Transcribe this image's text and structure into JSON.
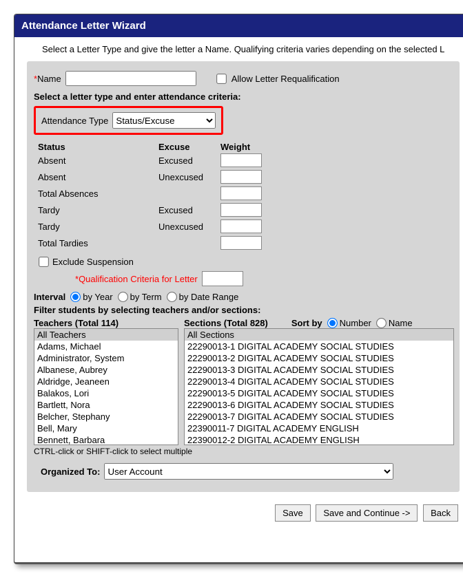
{
  "title": "Attendance Letter Wizard",
  "intro": "Select a Letter Type and give the letter a Name. Qualifying criteria varies depending on the selected L",
  "name": {
    "label": "Name",
    "value": ""
  },
  "allow_requal": {
    "label": "Allow Letter Requalification",
    "checked": false
  },
  "criteria_prompt": "Select a letter type and enter attendance criteria:",
  "attendance_type": {
    "label": "Attendance Type",
    "value": "Status/Excuse"
  },
  "columns": {
    "status": "Status",
    "excuse": "Excuse",
    "weight": "Weight"
  },
  "rows": [
    {
      "status": "Absent",
      "excuse": "Excused",
      "weight": ""
    },
    {
      "status": "Absent",
      "excuse": "Unexcused",
      "weight": ""
    },
    {
      "status": "Total Absences",
      "excuse": "",
      "weight": ""
    },
    {
      "status": "Tardy",
      "excuse": "Excused",
      "weight": ""
    },
    {
      "status": "Tardy",
      "excuse": "Unexcused",
      "weight": ""
    },
    {
      "status": "Total Tardies",
      "excuse": "",
      "weight": ""
    }
  ],
  "exclude_suspension": {
    "label": "Exclude Suspension",
    "checked": false
  },
  "qualification": {
    "label": "Qualification Criteria for Letter",
    "value": ""
  },
  "interval": {
    "label": "Interval",
    "selected": "by_year",
    "options": {
      "by_year": "by Year",
      "by_term": "by Term",
      "by_date_range": "by Date Range"
    }
  },
  "filter_prompt": "Filter students by selecting teachers and/or sections:",
  "teachers": {
    "label": "Teachers (Total 114)",
    "items": [
      "All Teachers",
      "Adams, Michael",
      "Administrator, System",
      "Albanese, Aubrey",
      "Aldridge, Jeaneen",
      "Balakos, Lori",
      "Bartlett, Nora",
      "Belcher, Stephany",
      "Bell, Mary",
      "Bennett, Barbara"
    ],
    "selected": "All Teachers"
  },
  "sections": {
    "label": "Sections (Total 828)",
    "sort_label": "Sort by",
    "sort_selected": "number",
    "sort_options": {
      "number": "Number",
      "name": "Name"
    },
    "items": [
      "All Sections",
      "22290013-1 DIGITAL ACADEMY SOCIAL STUDIES",
      "22290013-2 DIGITAL ACADEMY SOCIAL STUDIES",
      "22290013-3 DIGITAL ACADEMY SOCIAL STUDIES",
      "22290013-4 DIGITAL ACADEMY SOCIAL STUDIES",
      "22290013-5 DIGITAL ACADEMY SOCIAL STUDIES",
      "22290013-6 DIGITAL ACADEMY SOCIAL STUDIES",
      "22290013-7 DIGITAL ACADEMY SOCIAL STUDIES",
      "22390011-7 DIGITAL ACADEMY ENGLISH",
      "22390012-2 DIGITAL ACADEMY ENGLISH"
    ],
    "selected": "All Sections"
  },
  "multiselect_hint": "CTRL-click or SHIFT-click to select multiple",
  "organized_to": {
    "label": "Organized To:",
    "value": "User Account"
  },
  "buttons": {
    "save": "Save",
    "save_continue": "Save and Continue ->",
    "back": "Back"
  }
}
